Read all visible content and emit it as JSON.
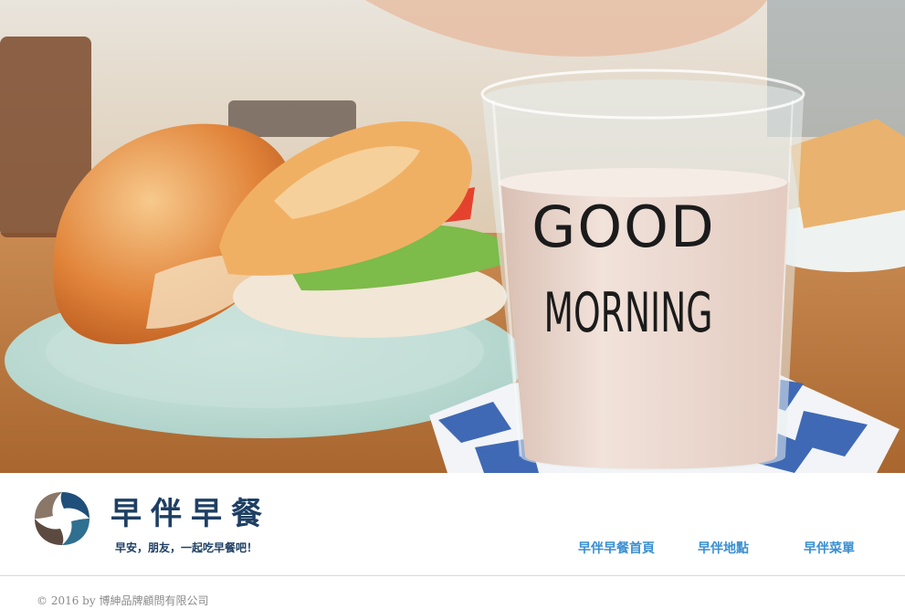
{
  "hero": {
    "mug_text_line1": "GOOD",
    "mug_text_line2": "MORNING"
  },
  "header": {
    "brand_title": "早伴早餐",
    "tagline": "早安，朋友，一起吃早餐吧！"
  },
  "nav": {
    "items": [
      {
        "label": "早伴早餐首頁"
      },
      {
        "label": "早伴地點"
      },
      {
        "label": "早伴菜單"
      }
    ]
  },
  "footer": {
    "copyright": "© 2016 by 博紳品牌顧問有限公司"
  },
  "colors": {
    "brand_navy": "#1e3f63",
    "nav_blue": "#3a8fd2",
    "footer_gray": "#8a8a8a"
  }
}
